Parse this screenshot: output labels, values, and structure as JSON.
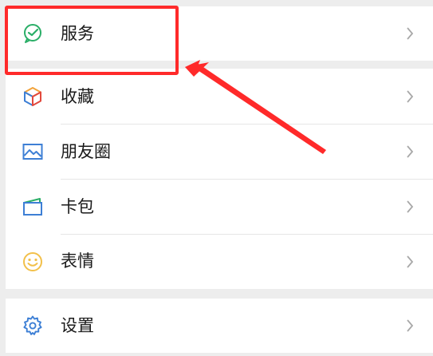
{
  "menu": {
    "items": [
      {
        "label": "服务",
        "icon": "wechat-pay-icon"
      },
      {
        "label": "收藏",
        "icon": "favorites-cube-icon"
      },
      {
        "label": "朋友圈",
        "icon": "moments-photo-icon"
      },
      {
        "label": "卡包",
        "icon": "card-wallet-icon"
      },
      {
        "label": "表情",
        "icon": "smiley-icon"
      },
      {
        "label": "设置",
        "icon": "gear-icon"
      }
    ]
  },
  "colors": {
    "highlight": "#ff2a2a",
    "background": "#ededed",
    "pay_green": "#2aae67",
    "icon_blue": "#3d7fd5",
    "smiley_yellow": "#f2c04a"
  }
}
